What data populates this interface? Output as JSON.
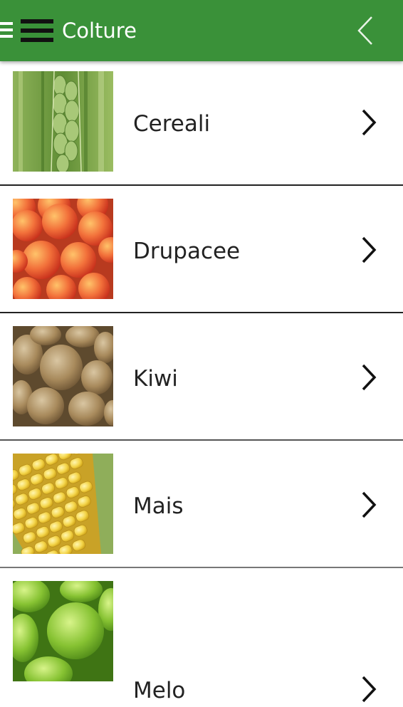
{
  "appbar": {
    "title": "Colture",
    "drawer_icon": "menu-icon",
    "back_icon": "chevron-left-icon",
    "background": "#3a9139"
  },
  "crops": [
    {
      "label": "Cereali",
      "image": "wheat-image"
    },
    {
      "label": "Drupacee",
      "image": "peaches-image"
    },
    {
      "label": "Kiwi",
      "image": "kiwi-image"
    },
    {
      "label": "Mais",
      "image": "corn-image"
    },
    {
      "label": "Melo",
      "image": "apples-image"
    }
  ],
  "row_icon": "chevron-right-icon"
}
